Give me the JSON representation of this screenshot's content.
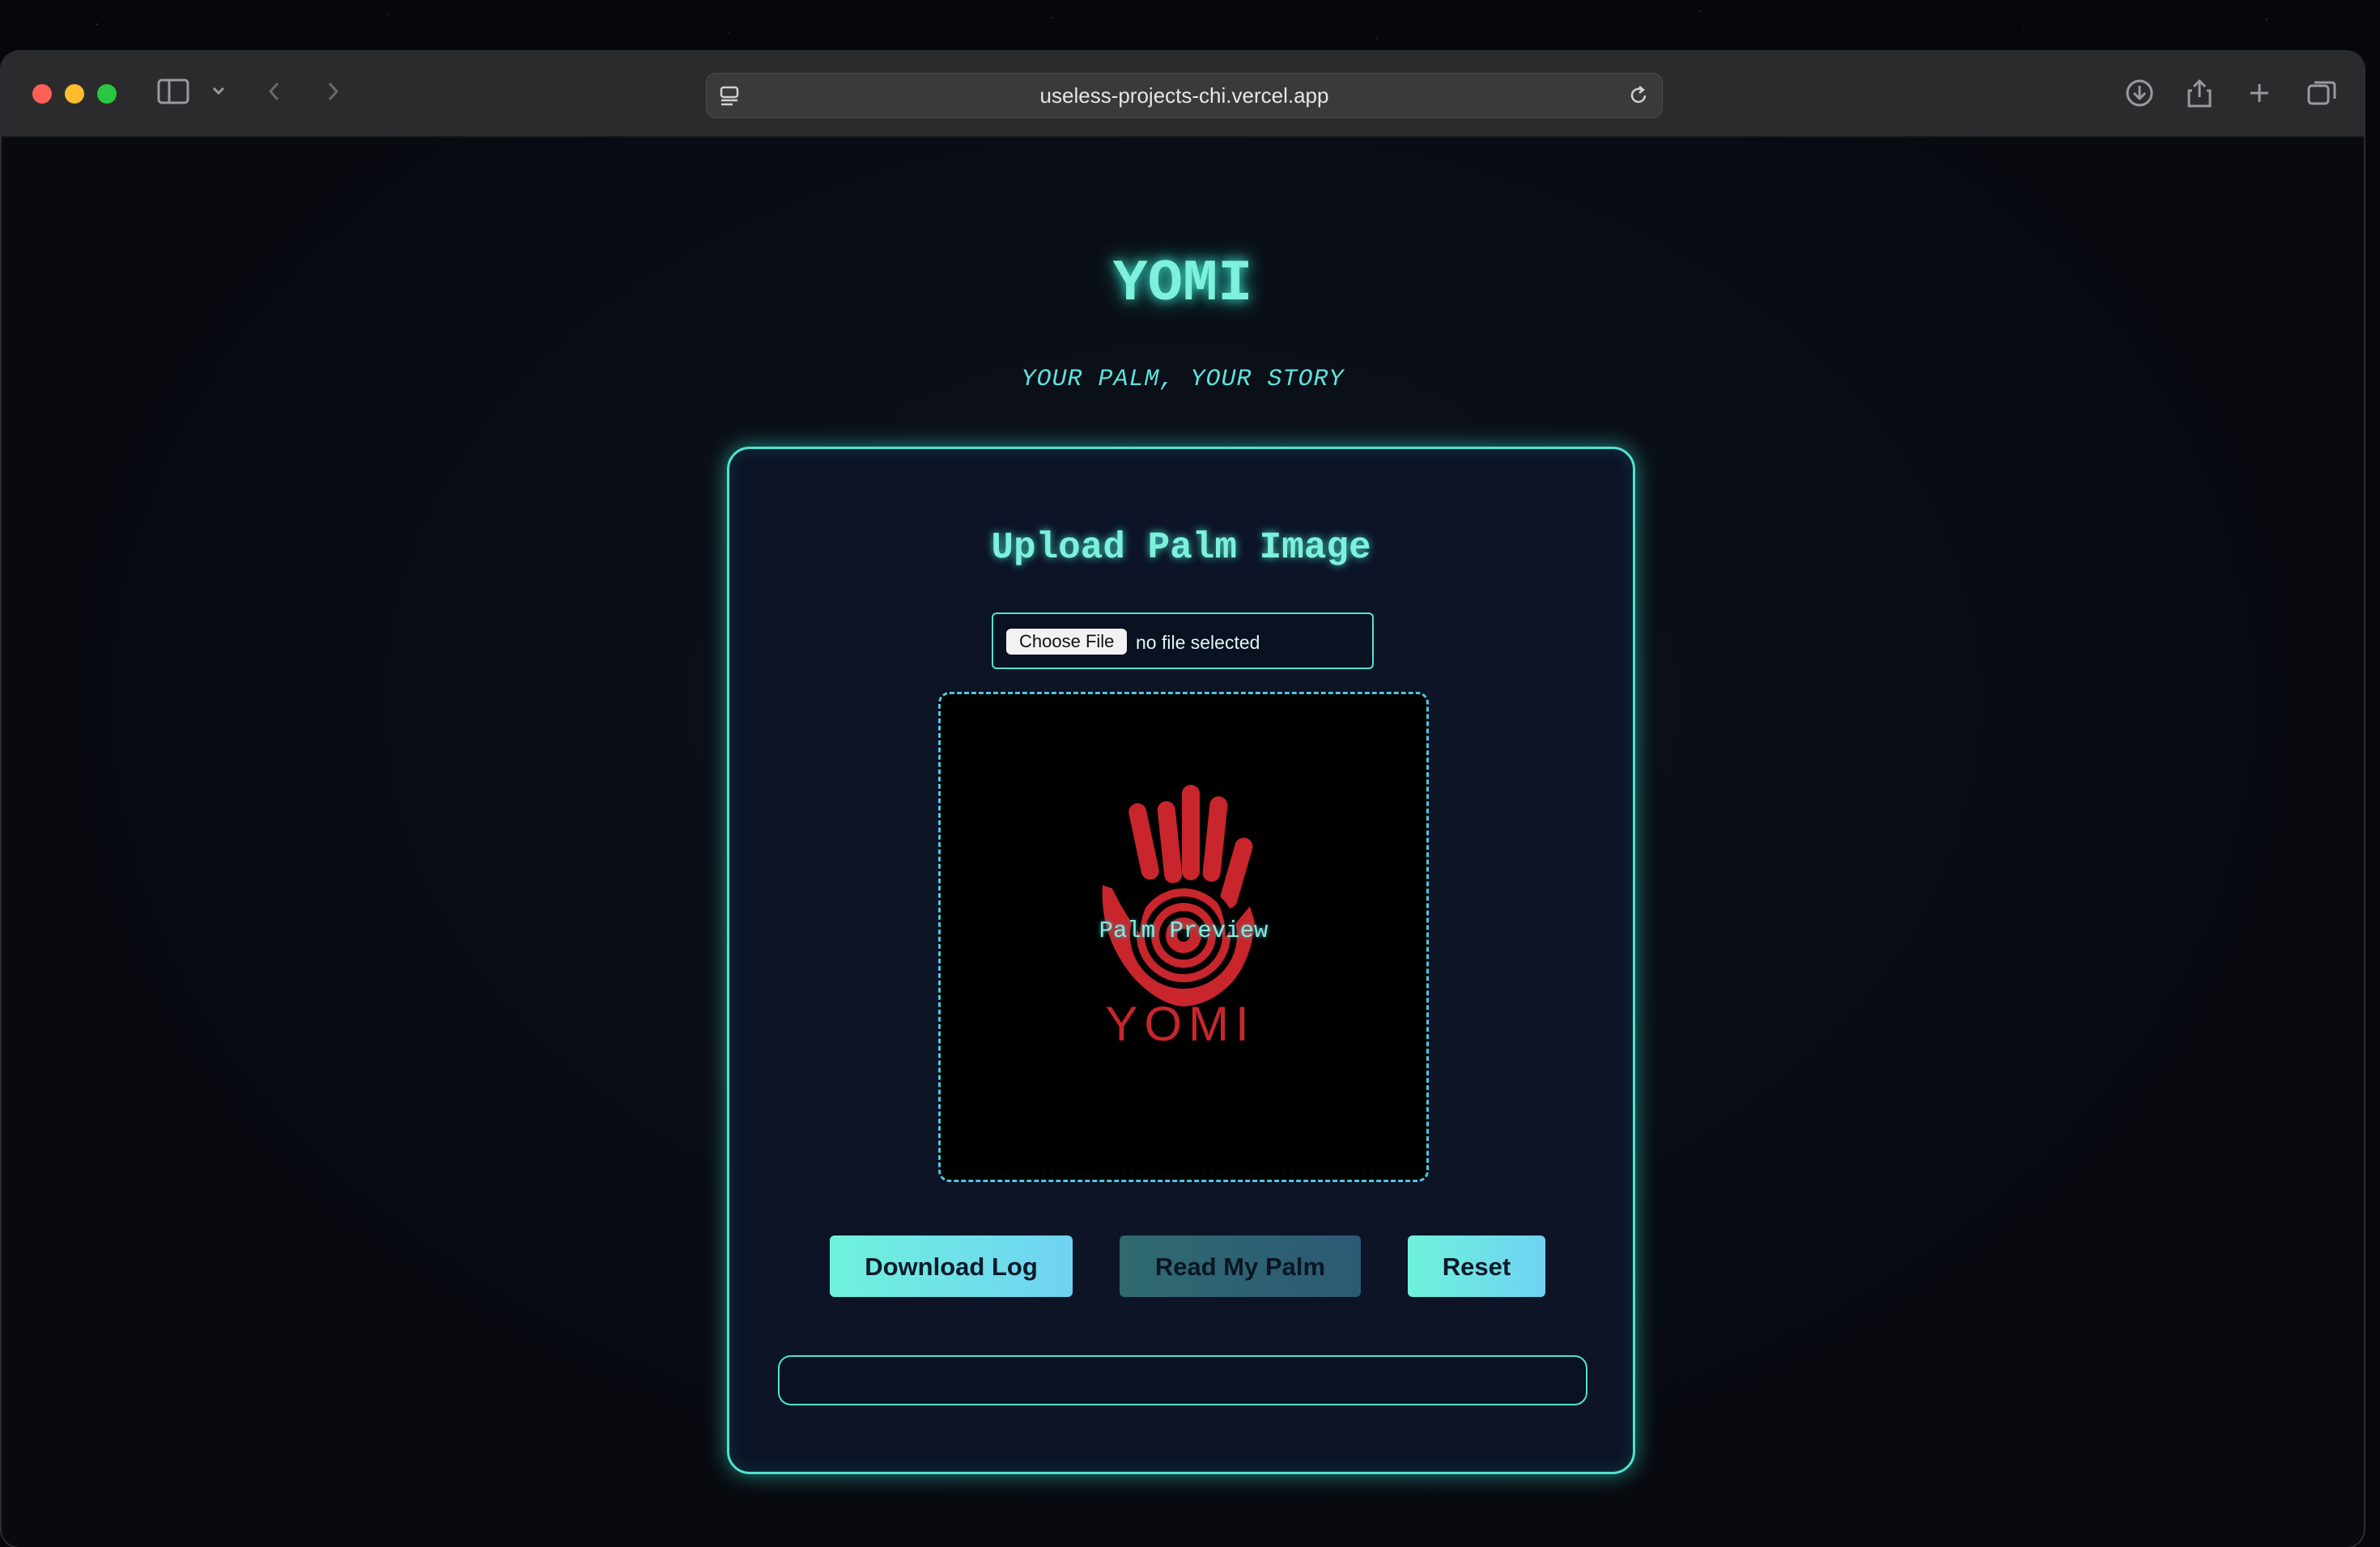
{
  "browser": {
    "url": "useless-projects-chi.vercel.app"
  },
  "header": {
    "title": "YOMI",
    "tagline": "YOUR PALM, YOUR STORY"
  },
  "upload": {
    "heading": "Upload Palm Image",
    "choose_label": "Choose File",
    "file_status": "no file selected",
    "preview_label": "Palm Preview",
    "logo_text": "YOMI"
  },
  "actions": {
    "download_label": "Download Log",
    "read_label": "Read My Palm",
    "reset_label": "Reset"
  },
  "output": {
    "text": ""
  },
  "colors": {
    "accent": "#4fe3cf",
    "logo_red": "#c8262c",
    "button_gradient_start": "#6ff2dc",
    "button_gradient_end": "#6fd2f2"
  }
}
